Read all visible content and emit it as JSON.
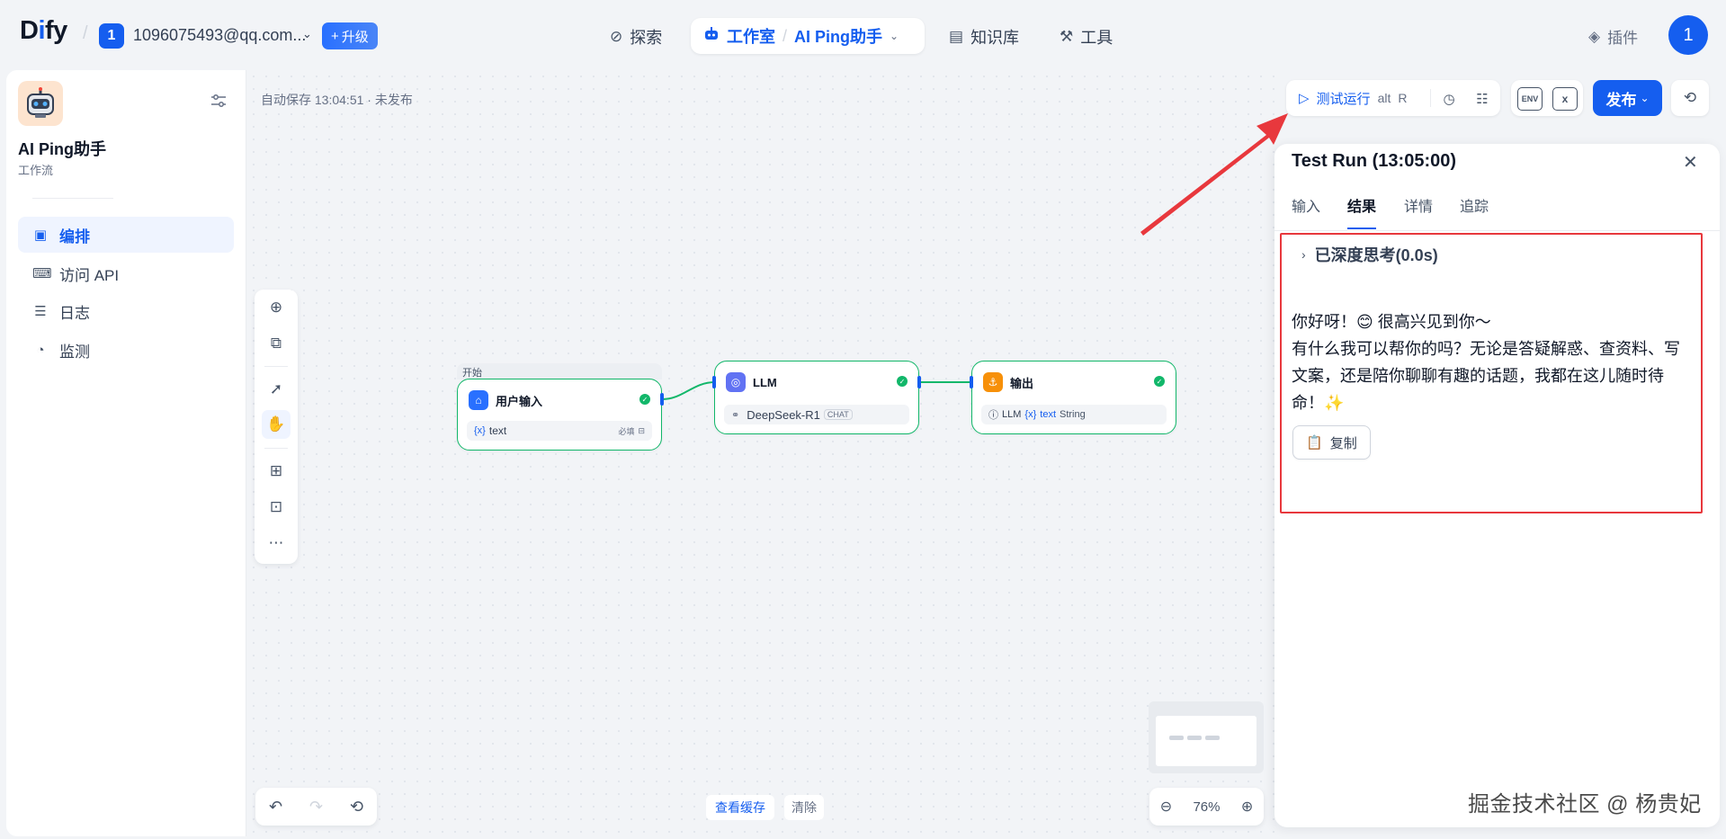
{
  "header": {
    "logo": "Dify",
    "workspace_initial": "1",
    "workspace_name": "1096075493@qq.com...",
    "upgrade_label": "升级",
    "nav": {
      "explore": "探索",
      "studio": "工作室",
      "app": "AI Ping助手",
      "knowledge": "知识库",
      "tools": "工具"
    },
    "plugins_label": "插件",
    "user_initial": "1"
  },
  "sidebar": {
    "app_name": "AI Ping助手",
    "app_type": "工作流",
    "items": [
      {
        "label": "编排",
        "icon": "layout-icon",
        "active": true
      },
      {
        "label": "访问 API",
        "icon": "terminal-icon",
        "active": false
      },
      {
        "label": "日志",
        "icon": "document-icon",
        "active": false
      },
      {
        "label": "监测",
        "icon": "gauge-icon",
        "active": false
      }
    ]
  },
  "canvas": {
    "autosave": "自动保存 13:04:51 · 未发布",
    "nodes": {
      "start_label": "开始",
      "start_title": "用户输入",
      "start_var": "text",
      "start_var_badge": "必填",
      "llm_title": "LLM",
      "llm_model": "DeepSeek-R1",
      "llm_mode": "CHAT",
      "end_title": "输出",
      "end_source": "LLM",
      "end_var": "text",
      "end_type": "String"
    },
    "view_cache_label": "查看缓存",
    "clear_label": "清除",
    "zoom": "76%"
  },
  "run_toolbar": {
    "test_run_label": "测试运行",
    "shortcut_alt": "alt",
    "shortcut_key": "R",
    "env_label": "ENV",
    "publish_label": "发布"
  },
  "test_run": {
    "title": "Test Run (13:05:00)",
    "tabs": [
      "输入",
      "结果",
      "详情",
      "追踪"
    ],
    "active_tab": "结果",
    "thinking_label": "已深度思考(0.0s)",
    "answer_line1": "你好呀！😊 很高兴见到你～",
    "answer_line2": "有什么我可以帮你的吗？无论是答疑解惑、查资料、写文案，还是陪你聊聊有趣的话题，我都在这儿随时待命！✨",
    "copy_label": "复制"
  },
  "watermark": "掘金技术社区 @ 杨贵妃",
  "colors": {
    "accent": "#155eef",
    "success": "#12b76a",
    "annotation_red": "#e8383d"
  }
}
